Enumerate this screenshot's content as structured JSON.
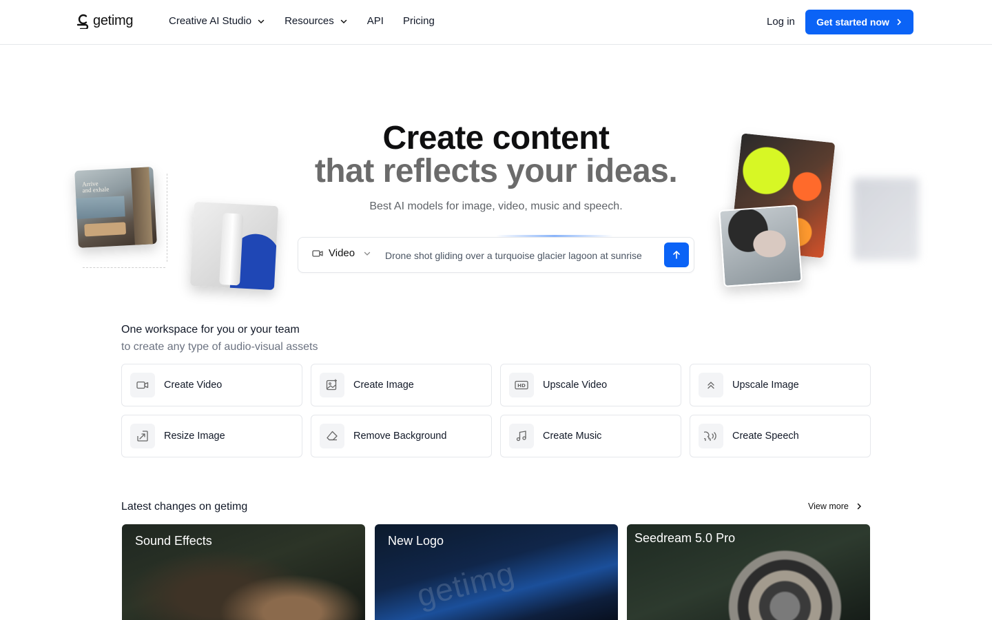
{
  "brand": {
    "name": "getimg",
    "accent": "#0b63f6"
  },
  "nav": {
    "items": [
      {
        "label": "Creative AI Studio",
        "dropdown": true
      },
      {
        "label": "Resources",
        "dropdown": true
      },
      {
        "label": "API",
        "dropdown": false
      },
      {
        "label": "Pricing",
        "dropdown": false
      }
    ],
    "login": "Log in",
    "cta": "Get started now"
  },
  "hero": {
    "title_line1": "Create content",
    "title_line2": "that reflects your ideas.",
    "subtitle": "Best AI models for image, video, music and speech.",
    "deco_card_text_line1": "Arrive",
    "deco_card_text_line2": "and exhale"
  },
  "prompt": {
    "mode": "Video",
    "value": "Drone shot gliding over a turquoise glacier lagoon at sunrise"
  },
  "workspace": {
    "title": "One workspace for you or your team",
    "subtitle": "to create any type of audio-visual assets",
    "tools": [
      {
        "label": "Create Video",
        "icon": "video-camera-icon"
      },
      {
        "label": "Create Image",
        "icon": "image-plus-icon"
      },
      {
        "label": "Upscale Video",
        "icon": "hd-icon"
      },
      {
        "label": "Upscale Image",
        "icon": "double-chevron-up-icon"
      },
      {
        "label": "Resize Image",
        "icon": "resize-arrow-icon"
      },
      {
        "label": "Remove Background",
        "icon": "eraser-icon"
      },
      {
        "label": "Create Music",
        "icon": "music-note-icon"
      },
      {
        "label": "Create Speech",
        "icon": "speech-head-icon"
      }
    ]
  },
  "latest": {
    "title": "Latest changes on getimg",
    "view_more": "View more",
    "cards": [
      {
        "title": "Sound Effects"
      },
      {
        "title": "New Logo"
      },
      {
        "title": "Seedream 5.0 Pro"
      }
    ],
    "card2_watermark": "getimg"
  }
}
